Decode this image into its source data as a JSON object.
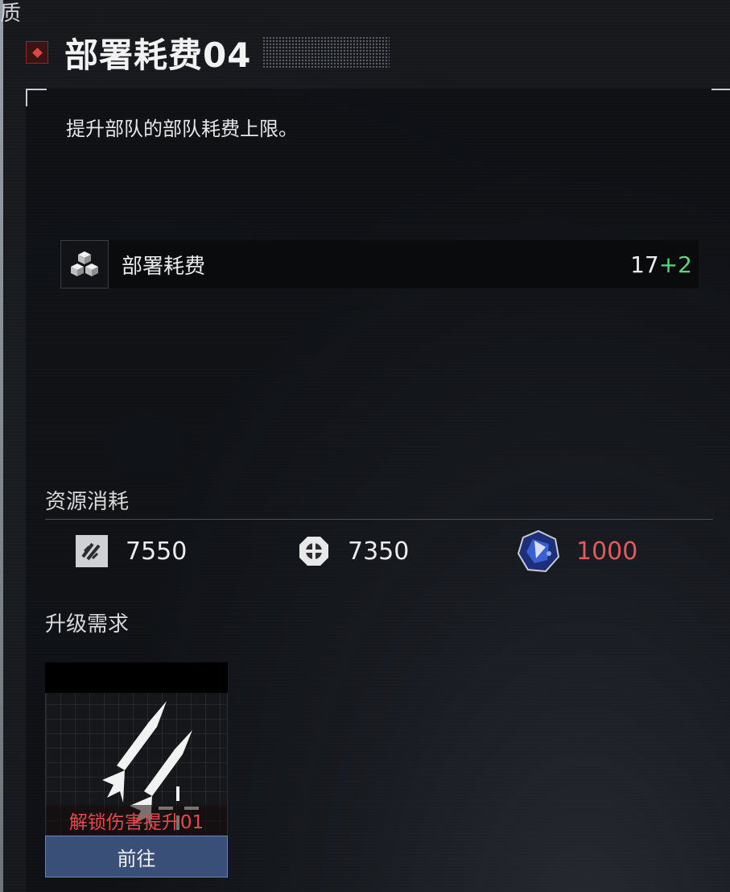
{
  "top_cut_text": "质",
  "title": "部署耗费04",
  "description": "提升部队的部队耗费上限。",
  "stat": {
    "icon": "cubes-icon",
    "label": "部署耗费",
    "base_value": "17",
    "bonus_value": "+2",
    "bonus_color": "#56d97a"
  },
  "resources": {
    "label": "资源消耗",
    "items": [
      {
        "icon": "alloy-icon",
        "value": "7550",
        "sufficient": true
      },
      {
        "icon": "gear-token-icon",
        "value": "7350",
        "sufficient": true
      },
      {
        "icon": "crystal-icon",
        "value": "1000",
        "sufficient": false,
        "color": "#e35a5a"
      }
    ]
  },
  "requirements": {
    "label": "升级需求",
    "card": {
      "icon": "missiles-icon",
      "name": "解锁伤害提升01",
      "button_label": "前往"
    }
  }
}
